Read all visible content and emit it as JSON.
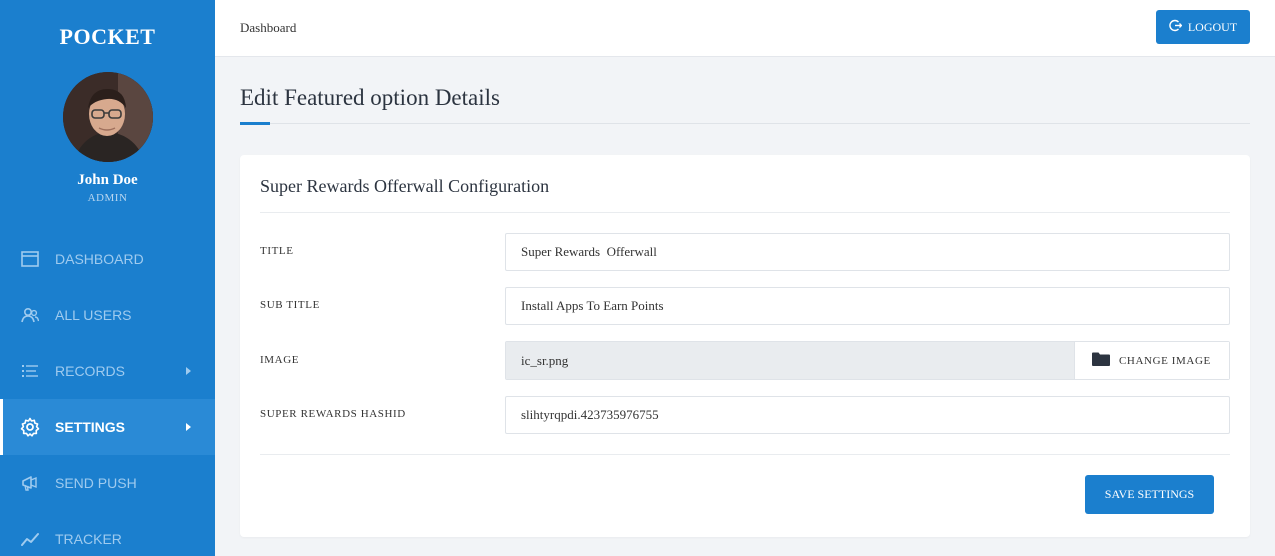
{
  "sidebar": {
    "brand": "POCKET",
    "user_name": "John Doe",
    "user_role": "ADMIN",
    "items": [
      {
        "label": "DASHBOARD",
        "icon": "browser-window-icon"
      },
      {
        "label": "ALL USERS",
        "icon": "users-icon"
      },
      {
        "label": "RECORDS",
        "icon": "list-icon"
      },
      {
        "label": "SETTINGS",
        "icon": "gear-icon"
      },
      {
        "label": "SEND PUSH",
        "icon": "megaphone-icon"
      },
      {
        "label": "TRACKER",
        "icon": "trend-line-icon"
      }
    ]
  },
  "header": {
    "breadcrumb": "Dashboard",
    "logout_label": "LOGOUT"
  },
  "main": {
    "page_title": "Edit Featured option Details",
    "card_title": "Super Rewards Offerwall Configuration",
    "fields": {
      "title_label": "TITLE",
      "title_value": "Super Rewards  Offerwall",
      "subtitle_label": "SUB TITLE",
      "subtitle_value": "Install Apps To Earn Points",
      "image_label": "IMAGE",
      "image_value": "ic_sr.png",
      "change_image_label": "CHANGE IMAGE",
      "hashid_label": "SUPER REWARDS HASHID",
      "hashid_value": "slihtyrqpdi.423735976755"
    },
    "save_label": "SAVE SETTINGS"
  },
  "colors": {
    "primary": "#1b7fce",
    "sidebar_active": "#2a8ad6",
    "page_bg": "#f2f4f7"
  }
}
